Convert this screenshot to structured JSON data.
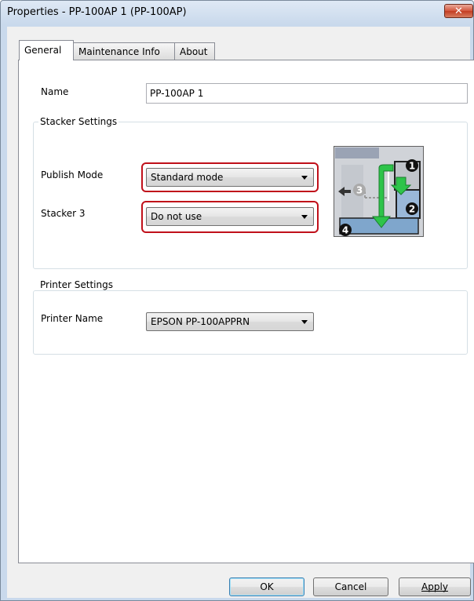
{
  "window": {
    "title": "Properties - PP-100AP 1 (PP-100AP)",
    "close_label": "✕"
  },
  "tabs": [
    {
      "label": "General",
      "selected": true
    },
    {
      "label": "Maintenance Info",
      "selected": false
    },
    {
      "label": "About",
      "selected": false
    }
  ],
  "general": {
    "name_label": "Name",
    "name_value": "PP-100AP 1",
    "stacker_settings": {
      "legend": "Stacker Settings",
      "publish_mode_label": "Publish Mode",
      "publish_mode_value": "Standard mode",
      "stacker3_label": "Stacker 3",
      "stacker3_value": "Do not use",
      "diagram_numbers": [
        "1",
        "2",
        "3",
        "4"
      ]
    },
    "printer_settings": {
      "legend": "Printer Settings",
      "printer_name_label": "Printer Name",
      "printer_name_value": "EPSON PP-100APPRN"
    }
  },
  "buttons": {
    "ok": "OK",
    "cancel": "Cancel",
    "apply": "Apply"
  },
  "colors": {
    "highlight_red": "#c0101a",
    "arrow_green": "#2ec44a",
    "title_blue": "#c9d9ec"
  }
}
